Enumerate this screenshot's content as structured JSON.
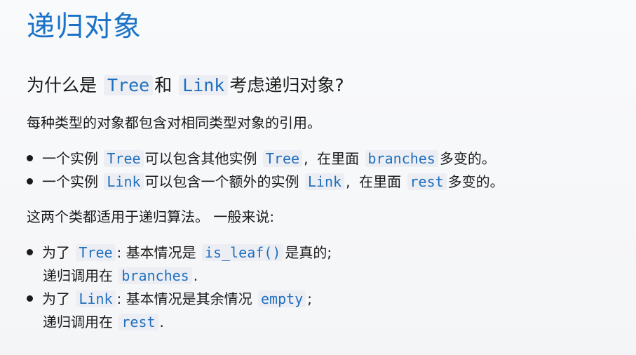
{
  "title": "递归对象",
  "heading": {
    "pre": "为什么是",
    "code1": "Tree",
    "mid": "和",
    "code2": "Link",
    "post": "考虑递归对象?"
  },
  "intro": "每种类型的对象都包含对相同类型对象的引用。",
  "bullets1": [
    {
      "pre": "一个实例",
      "code1": "Tree",
      "mid": "可以包含其他实例",
      "code2": "Tree",
      "mid2": ",  在里面",
      "code3": "branches",
      "post": "多变的。"
    },
    {
      "pre": "一个实例",
      "code1": "Link",
      "mid": "可以包含一个额外的实例",
      "code2": "Link",
      "mid2": ",  在里面",
      "code3": "rest",
      "post": "多变的。"
    }
  ],
  "summary": "这两个类都适用于递归算法。 一般来说:",
  "bullets2": [
    {
      "pre": "为了",
      "code1": "Tree",
      "mid": ": 基本情况是",
      "code2": "is_leaf()",
      "post": "是真的;",
      "cont_pre": "递归调用在",
      "cont_code": "branches",
      "cont_post": "."
    },
    {
      "pre": "为了",
      "code1": "Link",
      "mid": ": 基本情况是其余情况",
      "code2": "empty",
      "post": ";",
      "cont_pre": "递归调用在",
      "cont_code": "rest",
      "cont_post": "."
    }
  ]
}
